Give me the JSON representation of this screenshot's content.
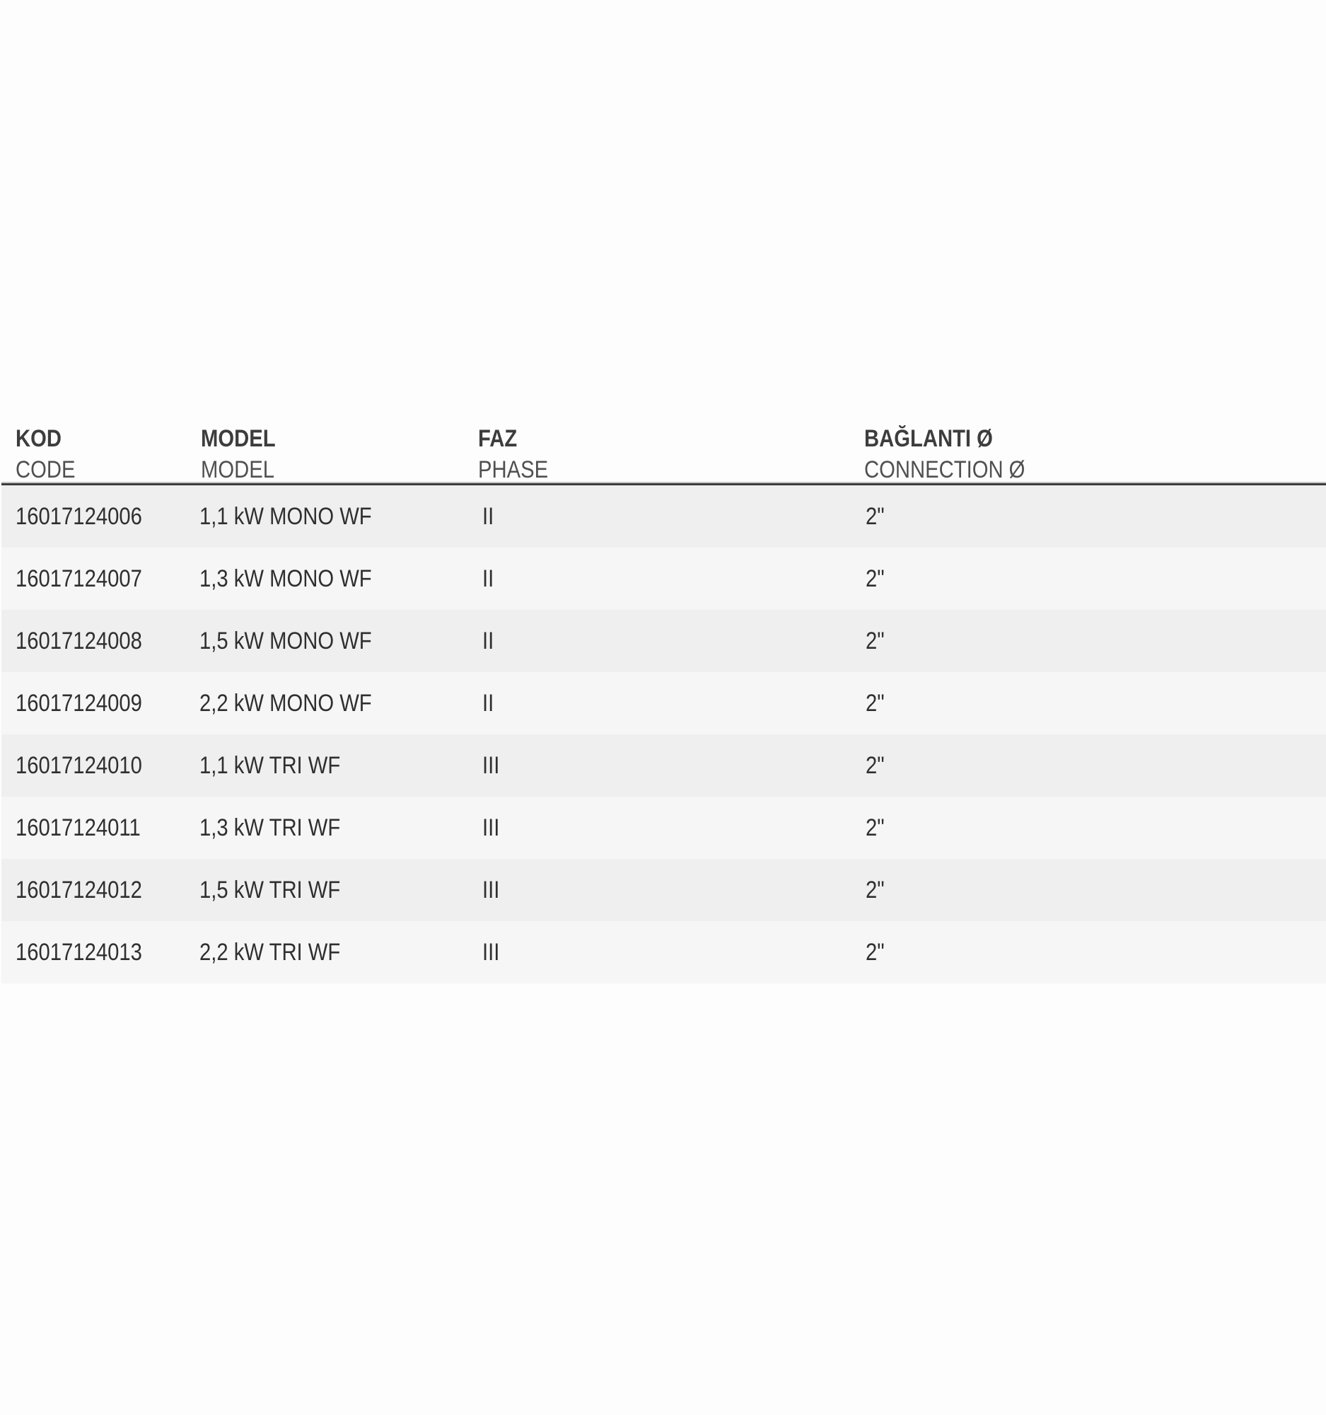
{
  "table": {
    "headers": [
      {
        "tr": "KOD",
        "en": "CODE"
      },
      {
        "tr": "MODEL",
        "en": "MODEL"
      },
      {
        "tr": "FAZ",
        "en": "PHASE"
      },
      {
        "tr": "BAĞLANTI Ø",
        "en": "CONNECTION Ø"
      }
    ],
    "rows": [
      {
        "code": "16017124006",
        "model": "1,1 kW MONO WF",
        "phase": "II",
        "connection": "2\""
      },
      {
        "code": "16017124007",
        "model": "1,3 kW MONO WF",
        "phase": "II",
        "connection": "2\""
      },
      {
        "code": "16017124008",
        "model": "1,5 kW MONO WF",
        "phase": "II",
        "connection": "2\""
      },
      {
        "code": "16017124009",
        "model": "2,2 kW MONO WF",
        "phase": "II",
        "connection": "2\""
      },
      {
        "code": "16017124010",
        "model": "1,1 kW TRI WF",
        "phase": "III",
        "connection": "2\""
      },
      {
        "code": "16017124011",
        "model": "1,3 kW TRI WF",
        "phase": "III",
        "connection": "2\""
      },
      {
        "code": "16017124012",
        "model": "1,5 kW TRI WF",
        "phase": "III",
        "connection": "2\""
      },
      {
        "code": "16017124013",
        "model": "2,2 kW TRI WF",
        "phase": "III",
        "connection": "2\""
      }
    ]
  },
  "colors": {
    "row_odd": "#efefef",
    "row_even": "#f6f6f6",
    "text": "#2f2f2f",
    "rule": "#3c3c3c"
  }
}
